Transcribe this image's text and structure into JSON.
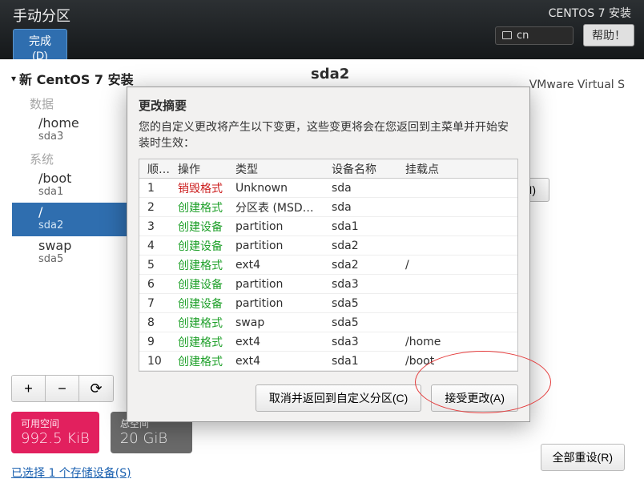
{
  "topbar": {
    "title": "手动分区",
    "done": "完成(D)",
    "install_title": "CENTOS 7 安装",
    "lang": "cn",
    "help": "帮助！"
  },
  "tree": {
    "header": "新 CentOS 7 安装",
    "section_data": "数据",
    "section_system": "系统",
    "items": [
      {
        "mount": "/home",
        "device": "sda3",
        "section": "data"
      },
      {
        "mount": "/boot",
        "device": "sda1",
        "section": "system"
      },
      {
        "mount": "/",
        "device": "sda2",
        "section": "system",
        "selected": true
      },
      {
        "mount": "swap",
        "device": "sda5",
        "section": "system"
      }
    ]
  },
  "toolbar": {
    "add": "+",
    "remove": "−",
    "reload": "⟳"
  },
  "space": {
    "avail_label": "可用空间",
    "avail_value": "992.5 KiB",
    "total_label": "总空间",
    "total_value": "20 GiB"
  },
  "devices_link": "已选择 1 个存储设备(S)",
  "right": {
    "title": "sda2",
    "device": "VMware Virtual S",
    "modify": "(M)",
    "reset": "全部重设(R)"
  },
  "dialog": {
    "title": "更改摘要",
    "desc": "您的自定义更改将产生以下变更，这些变更将会在您返回到主菜单并开始安装时生效：",
    "headers": {
      "order": "顺序",
      "op": "操作",
      "type": "类型",
      "devname": "设备名称",
      "mount": "挂载点"
    },
    "rows": [
      {
        "order": "1",
        "op": "销毁格式",
        "op_kind": "destroy",
        "type": "Unknown",
        "dev": "sda",
        "mount": ""
      },
      {
        "order": "2",
        "op": "创建格式",
        "op_kind": "create",
        "type": "分区表 (MSDOS)",
        "dev": "sda",
        "mount": ""
      },
      {
        "order": "3",
        "op": "创建设备",
        "op_kind": "create",
        "type": "partition",
        "dev": "sda1",
        "mount": ""
      },
      {
        "order": "4",
        "op": "创建设备",
        "op_kind": "create",
        "type": "partition",
        "dev": "sda2",
        "mount": ""
      },
      {
        "order": "5",
        "op": "创建格式",
        "op_kind": "create",
        "type": "ext4",
        "dev": "sda2",
        "mount": "/"
      },
      {
        "order": "6",
        "op": "创建设备",
        "op_kind": "create",
        "type": "partition",
        "dev": "sda3",
        "mount": ""
      },
      {
        "order": "7",
        "op": "创建设备",
        "op_kind": "create",
        "type": "partition",
        "dev": "sda5",
        "mount": ""
      },
      {
        "order": "8",
        "op": "创建格式",
        "op_kind": "create",
        "type": "swap",
        "dev": "sda5",
        "mount": ""
      },
      {
        "order": "9",
        "op": "创建格式",
        "op_kind": "create",
        "type": "ext4",
        "dev": "sda3",
        "mount": "/home"
      },
      {
        "order": "10",
        "op": "创建格式",
        "op_kind": "create",
        "type": "ext4",
        "dev": "sda1",
        "mount": "/boot"
      }
    ],
    "cancel": "取消并返回到自定义分区(C)",
    "accept": "接受更改(A)"
  }
}
